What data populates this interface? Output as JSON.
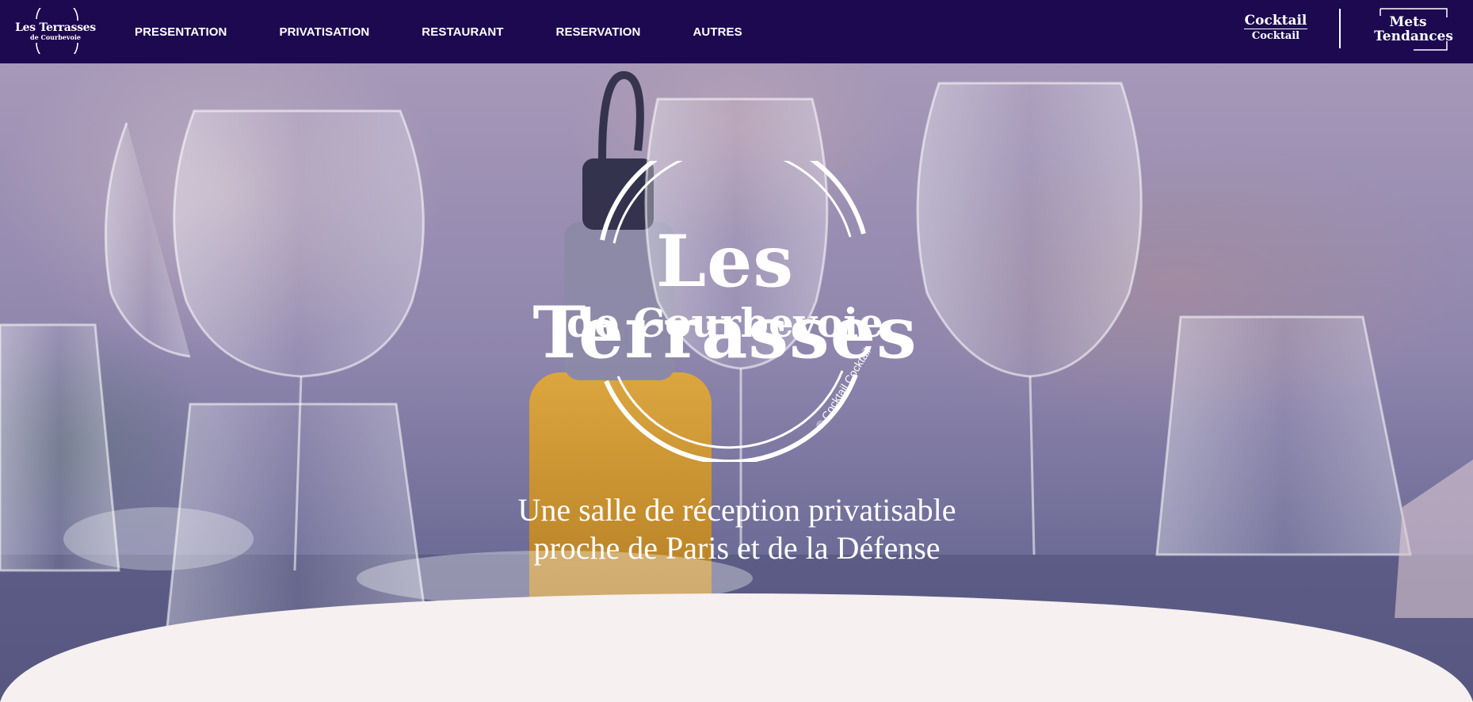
{
  "header": {
    "logo": {
      "line1": "Les Terrasses",
      "line2": "de Courbevoie"
    },
    "nav": [
      {
        "label": "PRESENTATION"
      },
      {
        "label": "PRIVATISATION"
      },
      {
        "label": "RESTAURANT"
      },
      {
        "label": "RESERVATION"
      },
      {
        "label": "AUTRES"
      }
    ],
    "partner_cocktail": {
      "line1": "Cocktail",
      "line2": "Cocktail"
    },
    "partner_mets": {
      "line1": "Mets",
      "line2": "Tendances"
    }
  },
  "hero": {
    "logo": {
      "title": "Les Terrasses",
      "subtitle": "de Courbevoie",
      "copyright": "© Cocktail Cocktail"
    },
    "tagline_line1": "Une salle de réception privatisable",
    "tagline_line2": "proche de Paris et de la Défense"
  },
  "colors": {
    "header_bg": "#1c0950",
    "text": "#ffffff",
    "section_bg": "#f6f0f0",
    "hero_overlay": "#6b5fa0"
  },
  "icons": {
    "logo_ring": "circle-ring-icon",
    "hero_photo": "wine-glasses-table-photo"
  }
}
